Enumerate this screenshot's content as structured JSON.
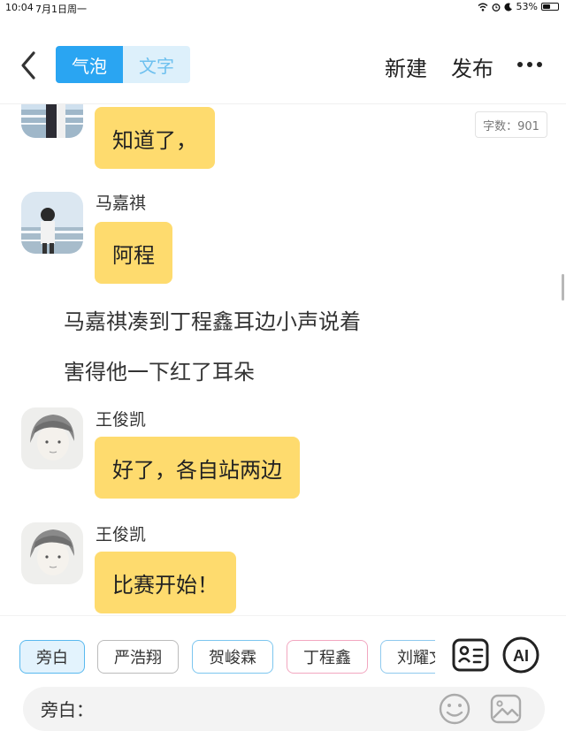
{
  "status_bar": {
    "time": "10:04",
    "date": "7月1日周一",
    "battery": "53%",
    "battery_level": 0.53
  },
  "header": {
    "tabs": [
      {
        "label": "气泡",
        "active": true
      },
      {
        "label": "文字",
        "active": false
      }
    ],
    "new_label": "新建",
    "publish_label": "发布"
  },
  "word_count": "字数：901",
  "messages": [
    {
      "type": "bubble",
      "speaker": "",
      "text": "知道了，"
    },
    {
      "type": "bubble",
      "speaker": "马嘉祺",
      "text": "阿程"
    },
    {
      "type": "narration",
      "text": "马嘉祺凑到丁程鑫耳边小声说着"
    },
    {
      "type": "narration",
      "text": "害得他一下红了耳朵"
    },
    {
      "type": "bubble",
      "speaker": "王俊凯",
      "text": "好了，各自站两边"
    },
    {
      "type": "bubble",
      "speaker": "王俊凯",
      "text": "比赛开始！"
    }
  ],
  "characters": [
    {
      "name": "旁白",
      "selected": true,
      "color": "#59b9ef"
    },
    {
      "name": "严浩翔",
      "selected": false,
      "color": "#bbbbbb"
    },
    {
      "name": "贺峻霖",
      "selected": false,
      "color": "#7cc6ef"
    },
    {
      "name": "丁程鑫",
      "selected": false,
      "color": "#f2a7c0"
    },
    {
      "name": "刘耀文",
      "selected": false,
      "color": "#8fc9ee"
    }
  ],
  "tools": {
    "ai_label": "AI"
  },
  "input": {
    "prefix": "旁白：",
    "value": "",
    "placeholder": ""
  },
  "colors": {
    "accent": "#2aa5f2",
    "bubble": "#fedb6e",
    "tab_inactive_bg": "#ddf0fb"
  }
}
